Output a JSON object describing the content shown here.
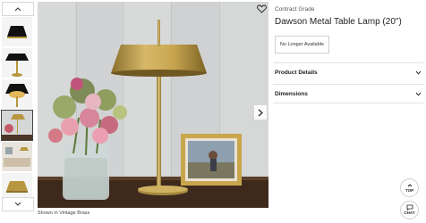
{
  "gallery": {
    "caption": "Shown in Vintage Brass",
    "thumbnails": [
      {
        "icon": "lamp-black-shade-thumbnail"
      },
      {
        "icon": "lamp-black-side-thumbnail"
      },
      {
        "icon": "lamp-black-lit-thumbnail"
      },
      {
        "icon": "lamp-brass-room-thumbnail",
        "selected": true
      },
      {
        "icon": "lamp-room-scene-thumbnail"
      },
      {
        "icon": "lamp-brass-thumbnail"
      }
    ]
  },
  "product": {
    "grade": "Contract Grade",
    "title": "Dawson Metal Table Lamp (20\")",
    "status": "No Longer Available"
  },
  "accordion": [
    {
      "label": "Product Details"
    },
    {
      "label": "Dimensions"
    }
  ],
  "floating": {
    "top_label": "TOP",
    "chat_label": "CHAT"
  },
  "colors": {
    "brass": "#b8963f",
    "wall": "#d5d6d6"
  }
}
